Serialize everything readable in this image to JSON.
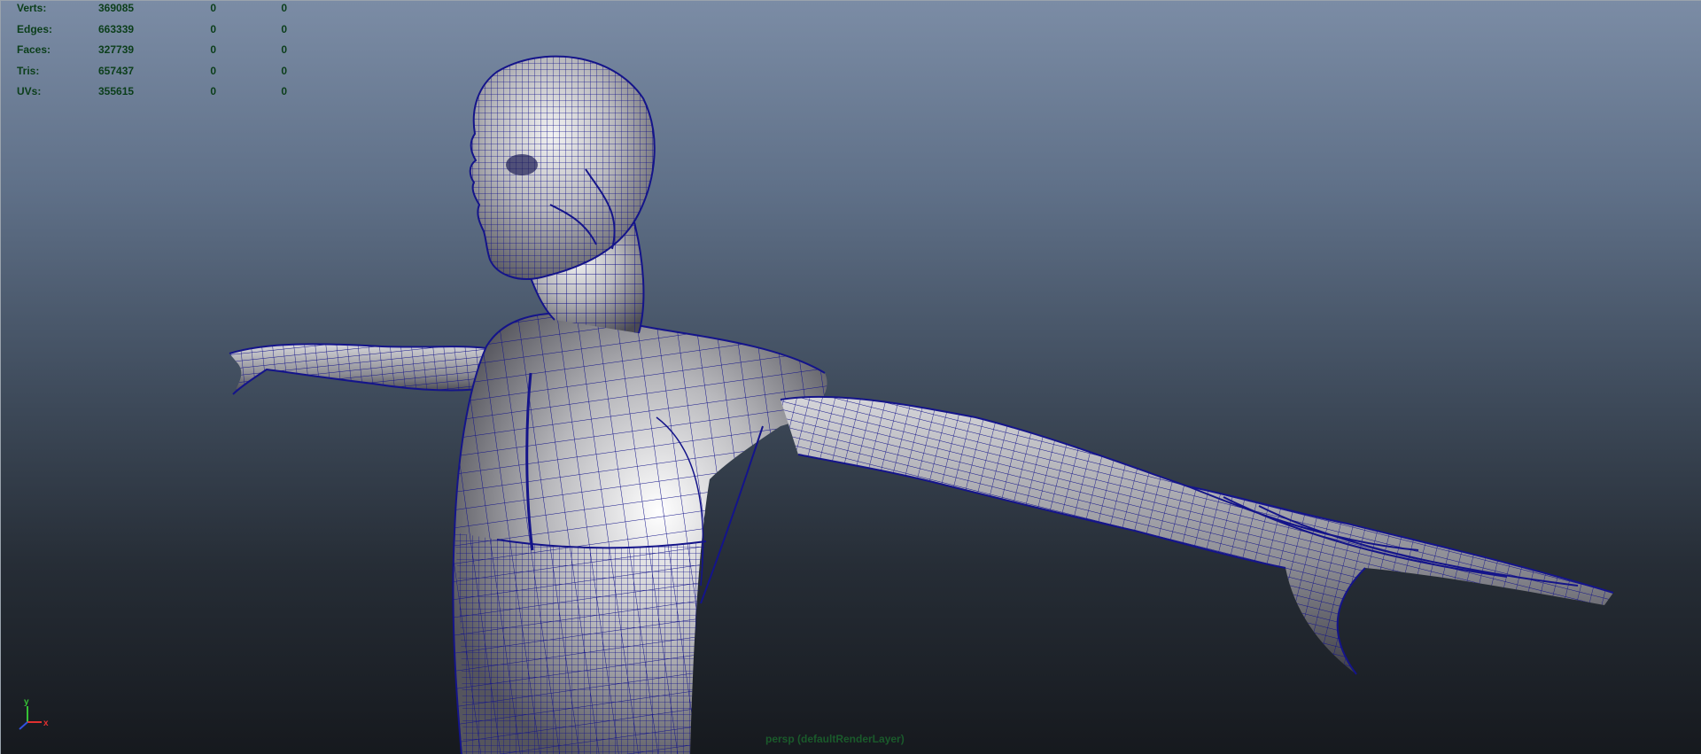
{
  "hud": {
    "rows": [
      {
        "label": "Verts:",
        "total": "369085",
        "selected": "0",
        "component": "0"
      },
      {
        "label": "Edges:",
        "total": "663339",
        "selected": "0",
        "component": "0"
      },
      {
        "label": "Faces:",
        "total": "327739",
        "selected": "0",
        "component": "0"
      },
      {
        "label": "Tris:",
        "total": "657437",
        "selected": "0",
        "component": "0"
      },
      {
        "label": "UVs:",
        "total": "355615",
        "selected": "0",
        "component": "0"
      }
    ]
  },
  "camera_label": "persp (defaultRenderLayer)",
  "axis_gizmo": {
    "y_label": "y",
    "x_label": "x",
    "y_color": "#35c035",
    "x_color": "#e03030",
    "z_color": "#3050e0"
  },
  "colors": {
    "wireframe": "#14148a",
    "hud_text": "#0b3e1a",
    "camera_text": "#1a5a2b",
    "viewport_top": "#7b8ca5",
    "viewport_bottom": "#16191e"
  },
  "icons": [
    "axis-gizmo-icon"
  ]
}
